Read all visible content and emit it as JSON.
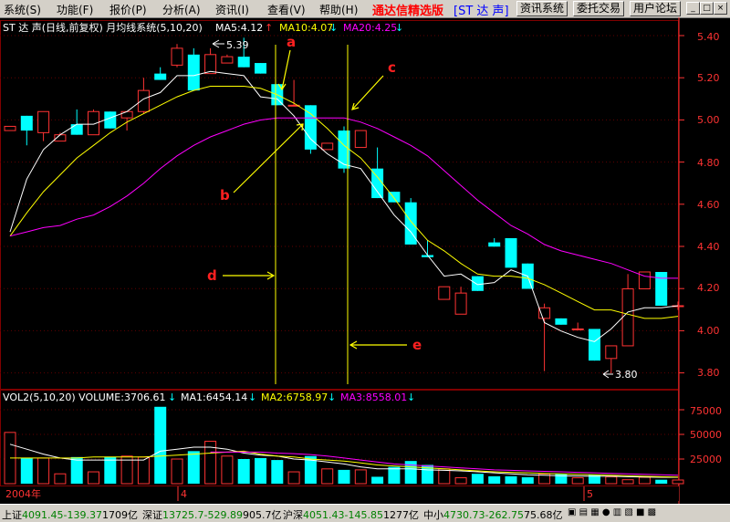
{
  "menu": {
    "items": [
      "系统(S)",
      "功能(F)",
      "报价(P)",
      "分析(A)",
      "资讯(I)",
      "查看(V)",
      "帮助(H)"
    ],
    "brand": "通达信精选版",
    "stock_label": "[ST 达 声]",
    "buttons": [
      "资讯系统",
      "委托交易",
      "用户论坛"
    ]
  },
  "window_buttons": [
    "_",
    "□",
    "×"
  ],
  "price_panel": {
    "title": "ST 达 声(日线,前复权) 月均线系统(5,10,20)",
    "ma5": "MA5:4.12",
    "ma10": "MA10:4.07",
    "ma20": "MA20:4.25",
    "high_label": "5.39",
    "low_label": "3.80",
    "y_ticks": [
      "5.40",
      "5.20",
      "5.00",
      "4.80",
      "4.60",
      "4.40",
      "4.20",
      "4.00",
      "3.80"
    ],
    "annotations": [
      "a",
      "b",
      "c",
      "d",
      "e"
    ]
  },
  "volume_panel": {
    "vol_title": "VOL2(5,10,20) VOLUME:3706.61",
    "ma1": "MA1:6454.14",
    "ma2": "MA2:6758.97",
    "ma3": "MA3:8558.01",
    "y_ticks": [
      "75000",
      "50000",
      "25000"
    ]
  },
  "axis": {
    "year_label": "2004年",
    "month_marks": [
      "4",
      "5"
    ]
  },
  "status_bar": {
    "sh": {
      "name": "上证",
      "price": "4091.45",
      "change": "-139.37",
      "amount": "1709亿"
    },
    "sz": {
      "name": "深证",
      "price": "13725.7",
      "change": "-529.89",
      "amount": "905.7亿"
    },
    "hs": {
      "name": "沪深",
      "price": "4051.43",
      "change": "-145.85",
      "amount": "1277亿"
    },
    "zx": {
      "name": "中小",
      "price": "4730.73",
      "change": "-262.75",
      "amount": "75.68亿"
    }
  },
  "colors": {
    "up": "#ff3333",
    "down": "#00ffff",
    "ma5": "#ffffff",
    "ma10": "#ffff00",
    "ma20": "#ff00ff",
    "annot": "#ff0000",
    "guide": "#ffff00"
  },
  "chart_data": {
    "type": "candlestick",
    "candles": [
      [
        4.95,
        4.97,
        4.97,
        4.95
      ],
      [
        5.02,
        4.95,
        5.02,
        4.88
      ],
      [
        4.94,
        5.04,
        5.04,
        4.9
      ],
      [
        4.9,
        4.93,
        4.94,
        4.9
      ],
      [
        4.98,
        4.93,
        5.05,
        4.93
      ],
      [
        4.93,
        5.04,
        5.05,
        4.93
      ],
      [
        5.04,
        4.96,
        5.04,
        4.96
      ],
      [
        5.01,
        5.04,
        5.04,
        4.95
      ],
      [
        5.04,
        5.14,
        5.2,
        5.03
      ],
      [
        5.22,
        5.19,
        5.25,
        5.19
      ],
      [
        5.26,
        5.34,
        5.36,
        5.25
      ],
      [
        5.31,
        5.14,
        5.34,
        5.14
      ],
      [
        5.22,
        5.31,
        5.34,
        5.22
      ],
      [
        5.27,
        5.3,
        5.31,
        5.27
      ],
      [
        5.3,
        5.25,
        5.39,
        5.25
      ],
      [
        5.27,
        5.22,
        5.27,
        5.22
      ],
      [
        5.17,
        5.07,
        5.17,
        5.07
      ],
      [
        5.07,
        5.07,
        5.19,
        5.07
      ],
      [
        5.07,
        4.86,
        5.07,
        4.84
      ],
      [
        4.86,
        4.89,
        4.89,
        4.86
      ],
      [
        4.95,
        4.77,
        4.97,
        4.75
      ],
      [
        4.87,
        4.95,
        4.95,
        4.87
      ],
      [
        4.77,
        4.63,
        4.87,
        4.63
      ],
      [
        4.66,
        4.61,
        4.66,
        4.61
      ],
      [
        4.61,
        4.41,
        4.63,
        4.41
      ],
      [
        4.36,
        4.35,
        4.43,
        4.35
      ],
      [
        4.15,
        4.21,
        4.21,
        4.15
      ],
      [
        4.08,
        4.18,
        4.21,
        4.08
      ],
      [
        4.26,
        4.19,
        4.26,
        4.19
      ],
      [
        4.42,
        4.4,
        4.44,
        4.4
      ],
      [
        4.44,
        4.3,
        4.44,
        4.3
      ],
      [
        4.32,
        4.2,
        4.32,
        4.2
      ],
      [
        4.06,
        4.11,
        4.13,
        3.81
      ],
      [
        4.06,
        4.03,
        4.06,
        4.03
      ],
      [
        4.01,
        4.01,
        4.04,
        4.01
      ],
      [
        4.01,
        3.86,
        4.01,
        3.86
      ],
      [
        3.87,
        3.93,
        3.93,
        3.8
      ],
      [
        3.93,
        4.2,
        4.27,
        3.93
      ],
      [
        4.2,
        4.28,
        4.28,
        4.2
      ],
      [
        4.28,
        4.12,
        4.28,
        4.12
      ],
      [
        4.12,
        4.12,
        4.14,
        4.1
      ]
    ],
    "ma5": [
      4.47,
      4.72,
      4.86,
      4.93,
      4.98,
      4.98,
      5.01,
      5.04,
      5.1,
      5.13,
      5.21,
      5.21,
      5.23,
      5.22,
      5.21,
      5.11,
      5.1,
      5.02,
      4.91,
      4.84,
      4.79,
      4.77,
      4.66,
      4.55,
      4.47,
      4.36,
      4.26,
      4.27,
      4.22,
      4.23,
      4.29,
      4.26,
      4.04,
      4.0,
      3.97,
      3.95,
      4.01,
      4.09,
      4.11,
      4.11,
      4.12
    ],
    "ma10": [
      4.45,
      4.56,
      4.66,
      4.74,
      4.82,
      4.88,
      4.94,
      4.99,
      5.03,
      5.07,
      5.11,
      5.14,
      5.16,
      5.16,
      5.16,
      5.15,
      5.12,
      5.08,
      5.03,
      4.96,
      4.88,
      4.82,
      4.73,
      4.63,
      4.52,
      4.43,
      4.38,
      4.32,
      4.27,
      4.26,
      4.26,
      4.25,
      4.22,
      4.18,
      4.14,
      4.1,
      4.1,
      4.08,
      4.06,
      4.06,
      4.07
    ],
    "ma20": [
      4.45,
      4.47,
      4.49,
      4.5,
      4.53,
      4.55,
      4.59,
      4.64,
      4.7,
      4.77,
      4.83,
      4.88,
      4.92,
      4.95,
      4.98,
      5.0,
      5.01,
      5.01,
      5.01,
      5.01,
      5.01,
      4.99,
      4.96,
      4.92,
      4.88,
      4.83,
      4.76,
      4.69,
      4.62,
      4.56,
      4.5,
      4.46,
      4.41,
      4.38,
      4.36,
      4.34,
      4.32,
      4.29,
      4.26,
      4.25,
      4.25
    ],
    "volume": [
      52000,
      26000,
      26000,
      10000,
      27000,
      12000,
      27000,
      28000,
      27000,
      78000,
      25000,
      33000,
      43000,
      28000,
      25000,
      26000,
      24000,
      12000,
      28000,
      15000,
      14000,
      14000,
      7000,
      17000,
      23000,
      19000,
      15000,
      6000,
      10000,
      7500,
      7500,
      6500,
      10000,
      10000,
      6000,
      9000,
      7000,
      4000,
      6500,
      4000,
      3700
    ],
    "vol_ma1": [
      40000,
      35000,
      30000,
      26000,
      24000,
      24000,
      24000,
      24000,
      24000,
      33000,
      35000,
      37000,
      37000,
      35000,
      31000,
      29000,
      28000,
      25000,
      24000,
      22000,
      20000,
      17000,
      15000,
      15000,
      15000,
      14000,
      13500,
      13000,
      12000,
      11000,
      10000,
      9000,
      8500,
      8000,
      7800,
      7500,
      7500,
      7000,
      6700,
      6500,
      6450
    ],
    "vol_ma2": [
      26000,
      26000,
      26000,
      26000,
      26000,
      27000,
      27000,
      27000,
      27000,
      28000,
      29000,
      30000,
      31000,
      32000,
      33000,
      30000,
      28000,
      27000,
      25000,
      24000,
      23000,
      21000,
      19000,
      18000,
      17000,
      16000,
      15000,
      14000,
      13000,
      12000,
      11500,
      11000,
      10500,
      10000,
      9500,
      9000,
      8500,
      8000,
      7500,
      7000,
      6760
    ],
    "vol_ma3": [
      null,
      null,
      null,
      null,
      null,
      null,
      null,
      null,
      null,
      null,
      null,
      null,
      32000,
      32000,
      32000,
      32000,
      31000,
      30500,
      29500,
      28000,
      26000,
      24000,
      22000,
      20000,
      19000,
      18000,
      17000,
      16000,
      15000,
      14000,
      13500,
      13000,
      12500,
      12000,
      11500,
      11000,
      10500,
      10000,
      9500,
      9000,
      8560
    ]
  }
}
